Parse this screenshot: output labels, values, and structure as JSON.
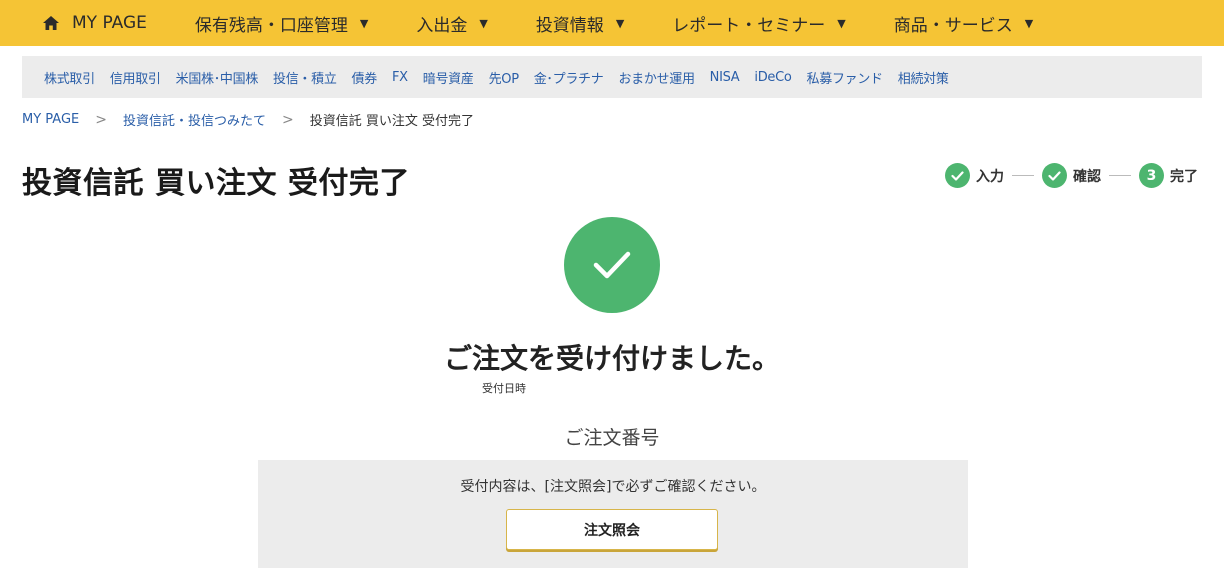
{
  "topnav": {
    "items": [
      {
        "label": "MY PAGE",
        "icon": "home-icon"
      },
      {
        "label": "保有残高・口座管理",
        "dropdown": true
      },
      {
        "label": "入出金",
        "dropdown": true
      },
      {
        "label": "投資情報",
        "dropdown": true
      },
      {
        "label": "レポート・セミナー",
        "dropdown": true
      },
      {
        "label": "商品・サービス",
        "dropdown": true
      }
    ],
    "caret": "▼",
    "background": "#f5c435"
  },
  "subnav": {
    "items": [
      "株式取引",
      "信用取引",
      "米国株･中国株",
      "投信・積立",
      "債券",
      "FX",
      "暗号資産",
      "先OP",
      "金･プラチナ",
      "おまかせ運用",
      "NISA",
      "iDeCo",
      "私募ファンド",
      "相続対策"
    ]
  },
  "breadcrumb": {
    "home": "MY PAGE",
    "section": "投資信託・投信つみたて",
    "current": "投資信託 買い注文 受付完了",
    "separator": ">"
  },
  "page": {
    "title": "投資信託 買い注文 受付完了"
  },
  "steps": {
    "input": "入力",
    "confirm": "確認",
    "done": "完了",
    "done_number": "3",
    "color": "#4db56f"
  },
  "result": {
    "icon": "check-icon",
    "message": "ご注文を受け付けました。",
    "accepted_datetime_label": "受付日時",
    "order_number_label": "ご注文番号"
  },
  "notice": {
    "text": "受付内容は、[注文照会]で必ずご確認ください。",
    "button_label": "注文照会"
  }
}
